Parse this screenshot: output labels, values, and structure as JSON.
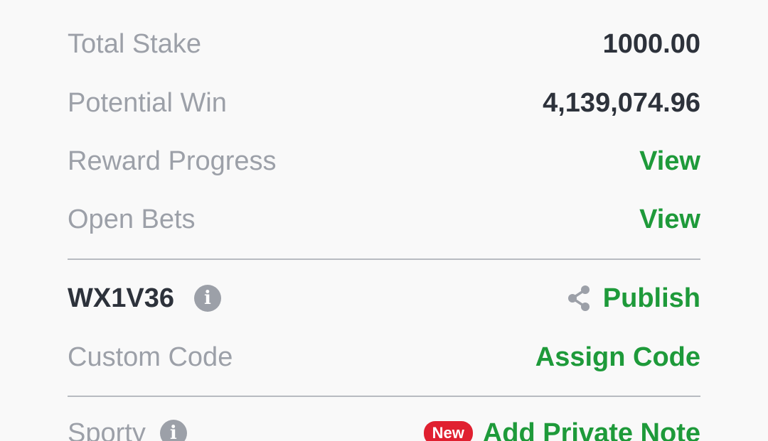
{
  "summary": {
    "total_stake_label": "Total Stake",
    "total_stake_value": "1000.00",
    "potential_win_label": "Potential Win",
    "potential_win_value": "4,139,074.96",
    "reward_progress_label": "Reward Progress",
    "reward_progress_link": "View",
    "open_bets_label": "Open Bets",
    "open_bets_link": "View"
  },
  "booking": {
    "code": "WX1V36",
    "info_icon": "info-icon",
    "share_icon": "share-icon",
    "publish_label": "Publish",
    "custom_code_label": "Custom Code",
    "assign_code_label": "Assign Code"
  },
  "sporty": {
    "label": "Sporty",
    "info_icon": "info-icon",
    "new_badge": "New",
    "add_note_label": "Add Private Note"
  },
  "colors": {
    "accent_green": "#1e9a3a",
    "label_gray": "#9ca0a8",
    "value_dark": "#2d323b",
    "badge_red": "#e02030",
    "background": "#f9f9f9"
  }
}
